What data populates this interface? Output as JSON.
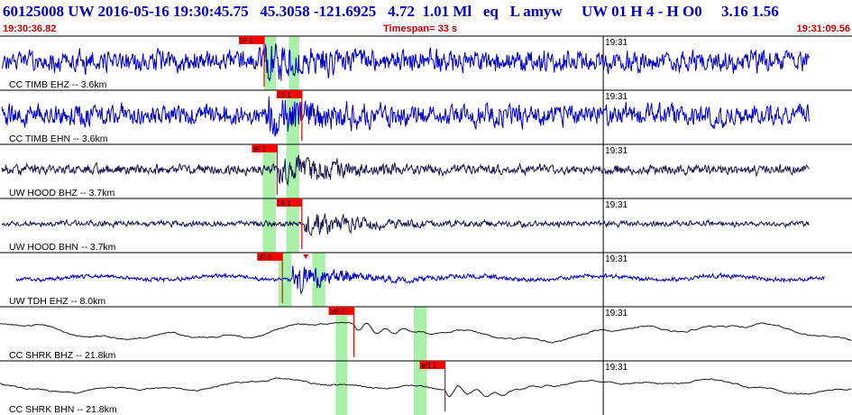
{
  "header": {
    "event_id": "60125008",
    "network": "UW",
    "origin_datetime": "2016-05-16 19:30:45.75",
    "latitude": "45.3058",
    "longitude": "-121.6925",
    "depth": "4.72",
    "magnitude": "1.01 Ml",
    "event_type": "eq",
    "flags": "L amyw",
    "right_block": "UW 01  H  4  -  H O0",
    "right_values": "3.16  1.56",
    "start_time": "19:30:36.82",
    "timespan_label": "Timespan=  33 s",
    "end_time": "19:31:09.56"
  },
  "colors": {
    "header_blue": "#0000cc",
    "header_red": "#cc0000",
    "trace_blue": "#0000cc",
    "trace_dark": "#1a1a50",
    "trace_black": "#1a1a1a",
    "pick_red": "#ff0000",
    "window_green": "#aaf0aa"
  },
  "chart_data": {
    "type": "line",
    "time_range_s": [
      0,
      32.74
    ],
    "minute_marker": {
      "label": "19:31",
      "time_s": 23.18
    },
    "traces": [
      {
        "label": "CC TIMB EHZ -- 3.6km",
        "color": "#0000cc",
        "amplitude": 0.75,
        "trace_end_s": 31.1,
        "picks": [
          {
            "label": "iP 1",
            "time_s": 10.15
          }
        ],
        "windows": [
          [
            10.15,
            10.6
          ],
          [
            11.1,
            11.5
          ]
        ],
        "burst": {
          "start_s": 10.2,
          "peak_amp": 1.0
        }
      },
      {
        "label": "CC TIMB EHN -- 3.6km",
        "color": "#0000cc",
        "amplitude": 0.72,
        "trace_end_s": 31.1,
        "picks": [
          {
            "label": "iS 1",
            "time_s": 11.6
          }
        ],
        "windows": [
          [
            11.0,
            11.5
          ]
        ],
        "burst": {
          "start_s": 10.3,
          "peak_amp": 1.0
        }
      },
      {
        "label": "UW HOOD BHZ -- 3.7km",
        "color": "#1a1a50",
        "amplitude": 0.35,
        "trace_end_s": 31.1,
        "picks": [
          {
            "label": "iP 1",
            "time_s": 10.65
          }
        ],
        "windows": [
          [
            10.1,
            10.6
          ],
          [
            11.0,
            11.5
          ]
        ],
        "burst": {
          "start_s": 10.7,
          "peak_amp": 1.0
        }
      },
      {
        "label": "UW HOOD BHN -- 3.7km",
        "color": "#1a1a50",
        "amplitude": 0.2,
        "trace_end_s": 31.1,
        "picks": [
          {
            "label": "iS 1",
            "time_s": 11.6
          }
        ],
        "windows": [
          [
            10.1,
            10.6
          ],
          [
            11.0,
            11.5
          ]
        ],
        "burst": {
          "start_s": 11.7,
          "peak_amp": 0.9
        }
      },
      {
        "label": "UW TDH EHZ -- 8.0km",
        "color": "#0000cc",
        "amplitude": 0.15,
        "trace_end_s": 31.7,
        "picks": [
          {
            "label": "iP 0",
            "time_s": 10.85
          }
        ],
        "windows": [
          [
            10.7,
            11.2
          ],
          [
            12.0,
            12.5
          ]
        ],
        "burst": {
          "start_s": 11.2,
          "peak_amp": 0.95
        }
      },
      {
        "label": "CC SHRK BHZ -- 21.8km",
        "color": "#1a1a1a",
        "amplitude": 0.75,
        "trace_end_s": 32.74,
        "picks": [
          {
            "label": "eP 2",
            "time_s": 13.6
          }
        ],
        "windows": [
          [
            12.9,
            13.35
          ],
          [
            15.9,
            16.4
          ]
        ],
        "burst": {
          "start_s": 13.6,
          "peak_amp": 0.4
        }
      },
      {
        "label": "CC SHRK BHN -- 21.8km",
        "color": "#1a1a1a",
        "amplitude": 0.6,
        "trace_end_s": 32.74,
        "picks": [
          {
            "label": "eS 1",
            "time_s": 17.1
          }
        ],
        "windows": [
          [
            12.9,
            13.35
          ],
          [
            15.9,
            16.4
          ]
        ],
        "burst": {
          "start_s": 17.1,
          "peak_amp": 0.45
        }
      }
    ]
  }
}
